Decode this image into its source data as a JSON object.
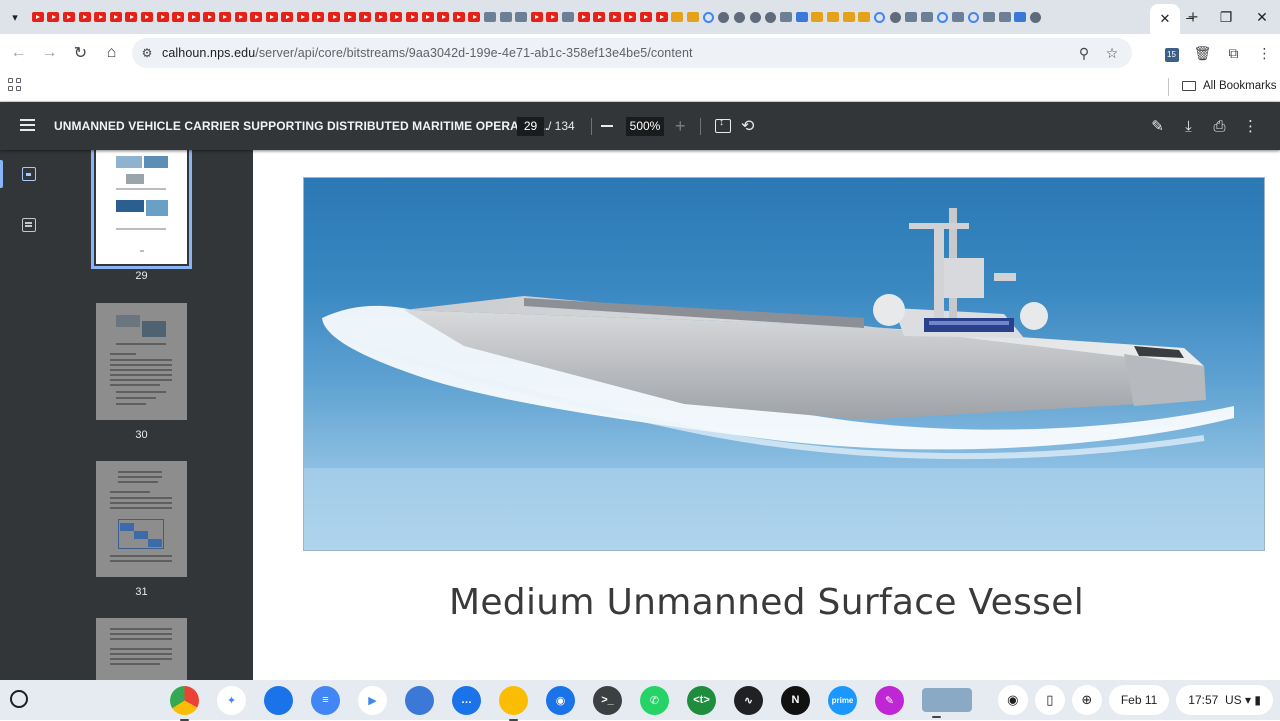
{
  "browser": {
    "tab_count_icons": "72",
    "active_tab_close": "✕",
    "new_tab": "+",
    "window_controls": {
      "minimize": "–",
      "restore": "❐",
      "close": "✕"
    }
  },
  "toolbar": {
    "back": "←",
    "forward": "→",
    "reload": "↻",
    "home": "⌂",
    "url_host": "calhoun.nps.edu",
    "url_path": "/server/api/core/bitstreams/9aa3042d-199e-4e71-ab1c-358ef13e4be5/content",
    "zoom_icon": "⚲",
    "star_icon": "☆",
    "ext_badge": "15",
    "menu_icon": "⋮"
  },
  "bookmarks": {
    "all_bookmarks": "All Bookmarks"
  },
  "pdf": {
    "title": "UNMANNED VEHICLE CARRIER SUPPORTING DISTRIBUTED MARITIME OPERATIO...",
    "current_page": "29",
    "total_pages": "/ 134",
    "zoom": "500%"
  },
  "sidebar": {
    "thumbnails": [
      {
        "label": "29",
        "active": true
      },
      {
        "label": "30",
        "active": false
      },
      {
        "label": "31",
        "active": false
      }
    ]
  },
  "document": {
    "caption": "Medium Unmanned Surface Vessel"
  },
  "shelf": {
    "apps": [
      {
        "name": "Chrome",
        "color": "#ea4335",
        "glyph": ""
      },
      {
        "name": "Gemini",
        "color": "#ffffff",
        "glyph": "✦"
      },
      {
        "name": "Files",
        "color": "#1a73e8",
        "glyph": ""
      },
      {
        "name": "Docs",
        "color": "#4285f4",
        "glyph": "≡"
      },
      {
        "name": "Play Store",
        "color": "#ffffff",
        "glyph": "▶"
      },
      {
        "name": "Gallery",
        "color": "#3c78d8",
        "glyph": ""
      },
      {
        "name": "Messages",
        "color": "#1a73e8",
        "glyph": "…"
      },
      {
        "name": "Keep",
        "color": "#fbbc04",
        "glyph": ""
      },
      {
        "name": "Camera",
        "color": "#1a73e8",
        "glyph": "◉"
      },
      {
        "name": "Terminal",
        "color": "#3c4043",
        "glyph": ">_"
      },
      {
        "name": "WhatsApp",
        "color": "#25d366",
        "glyph": "✆"
      },
      {
        "name": "Text",
        "color": "#1e8e3e",
        "glyph": "<t>"
      },
      {
        "name": "Stocks",
        "color": "#202124",
        "glyph": "∿"
      },
      {
        "name": "Netflix",
        "color": "#111111",
        "glyph": "N"
      },
      {
        "name": "Prime Video",
        "color": "#1a98ff",
        "glyph": "prime"
      },
      {
        "name": "Screencast",
        "color": "#c026d3",
        "glyph": "✎"
      }
    ],
    "date": "Feb 11",
    "time": "17:57",
    "locale": "US"
  }
}
